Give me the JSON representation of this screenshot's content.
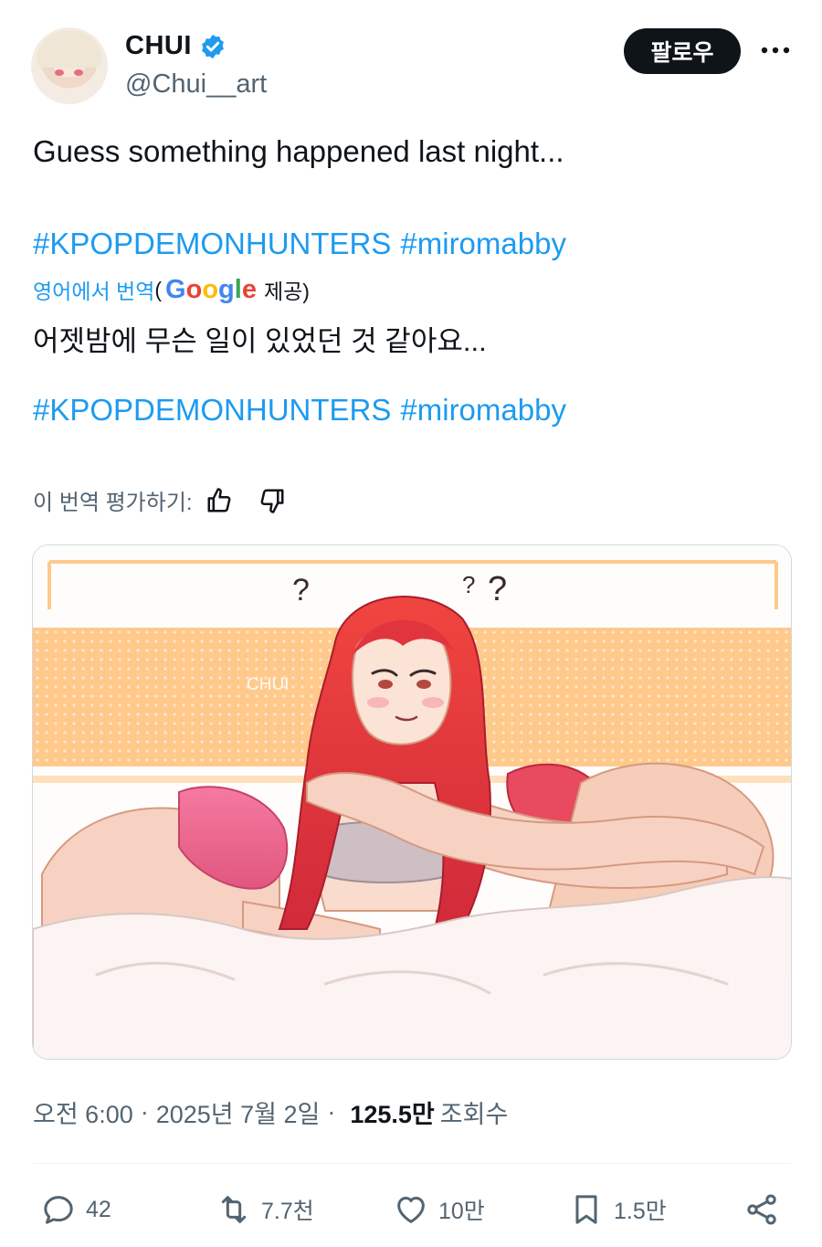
{
  "author": {
    "display_name": "CHUI",
    "handle": "@Chui__art",
    "verified": true,
    "avatar_icon": "avatar-image"
  },
  "header": {
    "follow_label": "팔로우",
    "more_icon": "more-horizontal-icon"
  },
  "tweet": {
    "text": "Guess something happened last night...",
    "hashtags": [
      "#KPOPDEMONHUNTERS",
      "#miromabby"
    ]
  },
  "translation": {
    "label": "영어에서 번역",
    "paren_open": "(",
    "provider_logo": "Google",
    "provided": "제공)",
    "text": "어젯밤에 무슨 일이 있었던 것 같아요...",
    "hashtags": [
      "#KPOPDEMONHUNTERS",
      "#miromabby"
    ],
    "rate_label": "이 번역 평가하기:"
  },
  "media": {
    "watermark": "CHUI",
    "question_marks": [
      "?",
      "?",
      "?"
    ]
  },
  "meta": {
    "time": "오전 6:00",
    "date": "2025년 7월 2일",
    "separator": "·",
    "views_count": "125.5만",
    "views_label": "조회수"
  },
  "actions": {
    "reply": "42",
    "retweet": "7.7천",
    "like": "10만",
    "bookmark": "1.5만"
  },
  "colors": {
    "accent": "#1d9bf0",
    "text": "#0f1419",
    "secondary": "#536471",
    "stripe": "#ffc98c",
    "hair": "#e8303c"
  }
}
